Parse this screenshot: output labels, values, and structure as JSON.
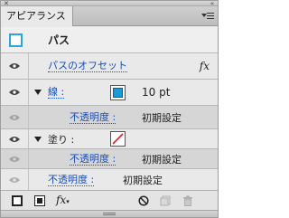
{
  "panel": {
    "tab_label": "アピアランス",
    "close_glyph": "✕",
    "collapse_glyph": "«",
    "menu_icon": "panel-menu-icon"
  },
  "header": {
    "object_label": "パス",
    "thumb_color": "#29a8e0"
  },
  "rows": {
    "path_offset": "パスのオフセット",
    "fx_label": "fx",
    "stroke_label": "線 :",
    "stroke_color": "#1b9ad6",
    "stroke_weight": "10 pt",
    "stroke_opacity_label": "不透明度 :",
    "stroke_opacity_value": "初期設定",
    "fill_label": "塗り :",
    "fill_swatch": "none-swatch",
    "fill_opacity_label": "不透明度 :",
    "fill_opacity_value": "初期設定",
    "opacity_label": "不透明度 :",
    "opacity_value": "初期設定"
  },
  "toolbar": {
    "fx_label": "fx",
    "icons": [
      "add-new-stroke-icon",
      "add-new-fill-icon",
      "add-effect-icon",
      "clear-appearance-icon",
      "duplicate-item-icon",
      "delete-item-icon"
    ]
  }
}
